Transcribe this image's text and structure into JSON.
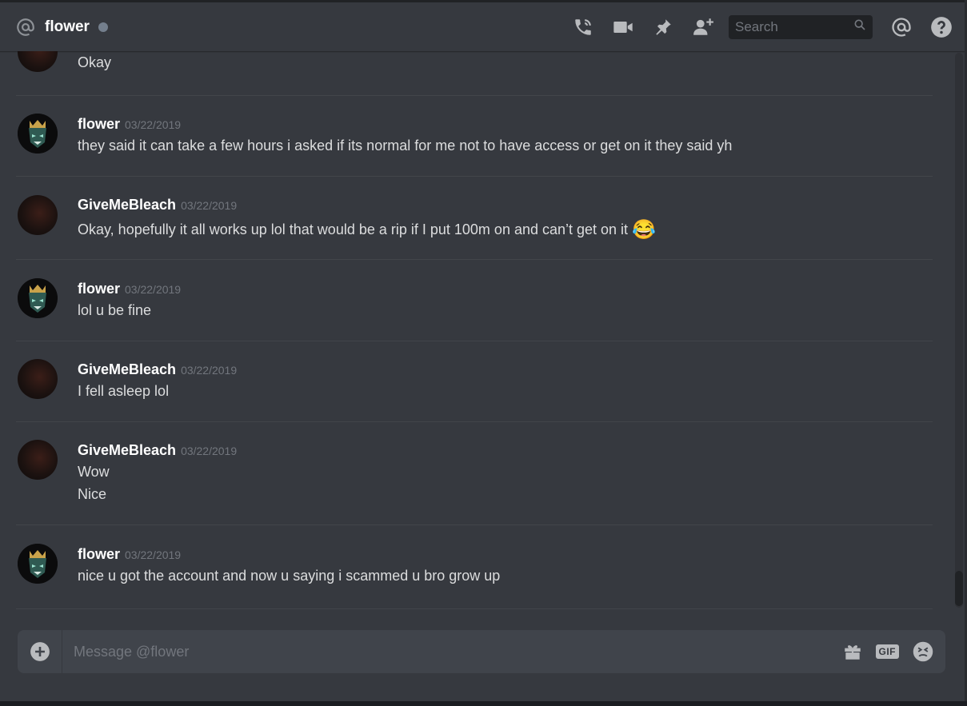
{
  "header": {
    "title": "flower",
    "search_placeholder": "Search"
  },
  "messages": [
    {
      "author": "",
      "timestamp": "",
      "lines": [
        "Okay"
      ],
      "avatar": "dark"
    },
    {
      "author": "flower",
      "timestamp": "03/22/2019",
      "lines": [
        "they said it can take a few hours i asked if its normal for me not to have access or get on it they said yh"
      ],
      "avatar": "monster"
    },
    {
      "author": "GiveMeBleach",
      "timestamp": "03/22/2019",
      "lines": [
        "Okay, hopefully it all works up lol that would be a rip if I put 100m on and can’t get on it"
      ],
      "emoji": "😂",
      "avatar": "dark"
    },
    {
      "author": "flower",
      "timestamp": "03/22/2019",
      "lines": [
        "lol u be fine"
      ],
      "avatar": "monster"
    },
    {
      "author": "GiveMeBleach",
      "timestamp": "03/22/2019",
      "lines": [
        "I fell asleep lol"
      ],
      "avatar": "dark"
    },
    {
      "author": "GiveMeBleach",
      "timestamp": "03/22/2019",
      "lines": [
        "Wow",
        "Nice"
      ],
      "avatar": "dark"
    },
    {
      "author": "flower",
      "timestamp": "03/22/2019",
      "lines": [
        "nice u got the account and now u saying i scammed u bro grow up"
      ],
      "avatar": "monster"
    }
  ],
  "composer": {
    "placeholder": "Message @flower",
    "gif_label": "GIF"
  },
  "colors": {
    "background": "#36393f",
    "status_offline": "#747f8d",
    "input_bg": "#40444b"
  }
}
